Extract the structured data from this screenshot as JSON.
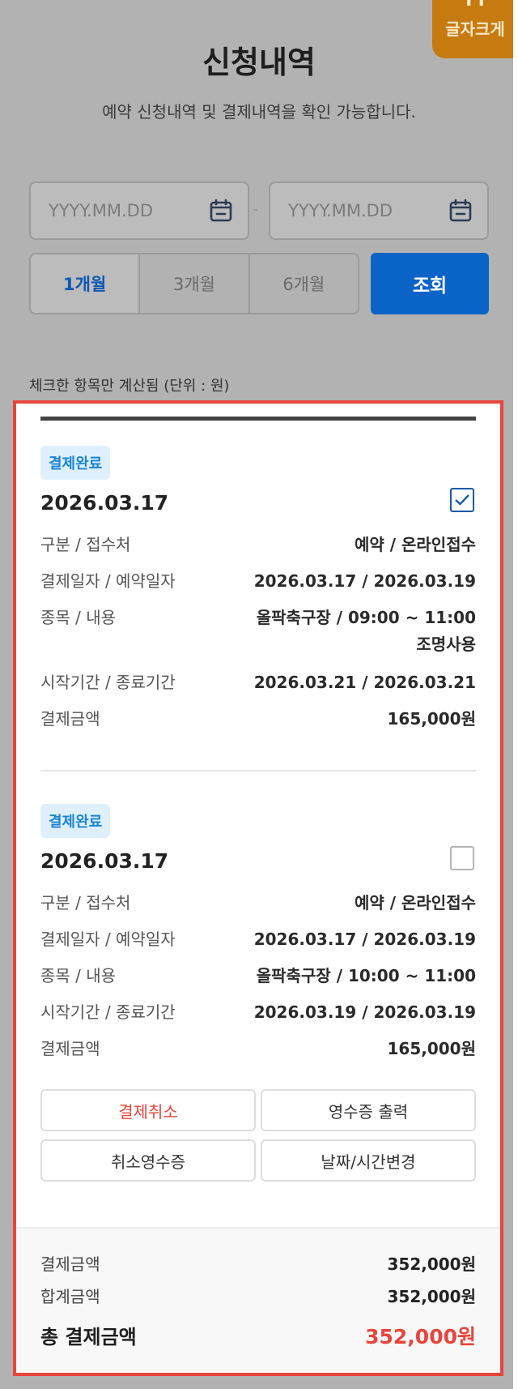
{
  "font_button": {
    "glyph": "TT",
    "label": "글자크게"
  },
  "header": {
    "title": "신청내역",
    "subtitle": "예약 신청내역 및 결제내역을 확인 가능합니다."
  },
  "filters": {
    "start_placeholder": "YYYY.MM.DD",
    "end_placeholder": "YYYY.MM.DD",
    "separator": "-",
    "periods": [
      "1개월",
      "3개월",
      "6개월"
    ],
    "selected_period": "1개월",
    "search_label": "조회"
  },
  "note": "체크한 항목만 계산됨 (단위 : 원)",
  "entries": [
    {
      "status": "결제완료",
      "date": "2026.03.17",
      "checked": true,
      "rows": [
        {
          "label": "구분 / 접수처",
          "value": "예약 / 온라인접수"
        },
        {
          "label": "결제일자 / 예약일자",
          "value": "2026.03.17 / 2026.03.19"
        },
        {
          "label": "종목 / 내용",
          "value": "올팍축구장 / 09:00 ~ 11:00",
          "value2": "조명사용"
        },
        {
          "label": "시작기간 / 종료기간",
          "value": "2026.03.21 / 2026.03.21"
        },
        {
          "label": "결제금액",
          "value": "165,000원"
        }
      ]
    },
    {
      "status": "결제완료",
      "date": "2026.03.17",
      "checked": false,
      "rows": [
        {
          "label": "구분 / 접수처",
          "value": "예약 / 온라인접수"
        },
        {
          "label": "결제일자 / 예약일자",
          "value": "2026.03.17 / 2026.03.19"
        },
        {
          "label": "종목 / 내용",
          "value": "올팍축구장 / 10:00 ~ 11:00"
        },
        {
          "label": "시작기간 / 종료기간",
          "value": "2026.03.19 / 2026.03.19"
        },
        {
          "label": "결제금액",
          "value": "165,000원"
        }
      ],
      "actions": [
        "결제취소",
        "영수증 출력",
        "취소영수증",
        "날짜/시간변경"
      ]
    }
  ],
  "summary": {
    "payment_label": "결제금액",
    "payment_value": "352,000원",
    "sum_label": "합계금액",
    "sum_value": "352,000원",
    "total_label": "총 결제금액",
    "total_value": "352,000원"
  },
  "colors": {
    "accent_blue": "#0a64c7",
    "status_badge": "#1a83d3",
    "highlight_red": "#e8453c",
    "font_button": "#c67a10"
  }
}
